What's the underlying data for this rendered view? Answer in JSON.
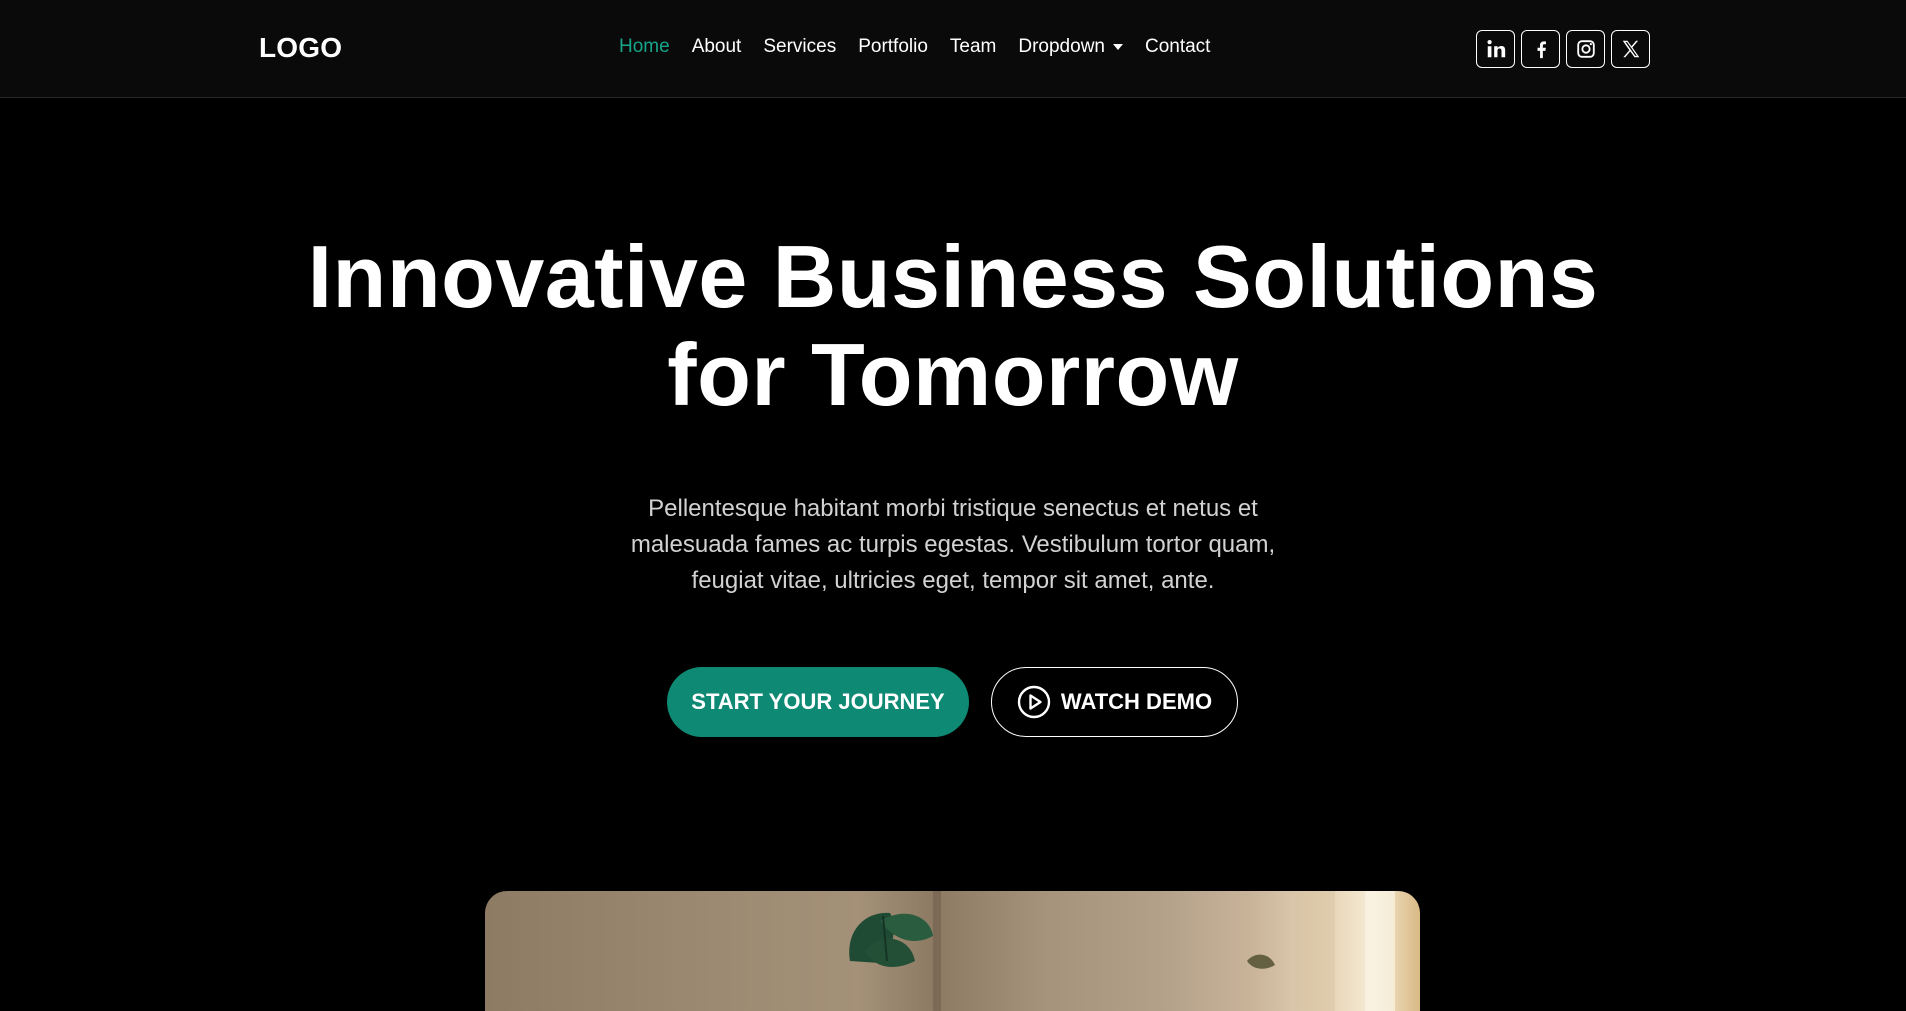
{
  "brand": {
    "logo": "LOGO",
    "accent": "#16a58a",
    "button_color": "#0e8a74"
  },
  "nav": {
    "items": [
      {
        "label": "Home",
        "active": true
      },
      {
        "label": "About"
      },
      {
        "label": "Services"
      },
      {
        "label": "Portfolio"
      },
      {
        "label": "Team"
      },
      {
        "label": "Dropdown",
        "has_caret": true
      },
      {
        "label": "Contact"
      }
    ]
  },
  "socials": [
    {
      "icon": "linkedin-icon"
    },
    {
      "icon": "facebook-icon"
    },
    {
      "icon": "instagram-icon"
    },
    {
      "icon": "x-twitter-icon"
    }
  ],
  "hero": {
    "title_line1": "Innovative Business Solutions",
    "title_line2": "for Tomorrow",
    "subtitle_line1": "Pellentesque habitant morbi tristique senectus et netus et",
    "subtitle_line2": "malesuada fames ac turpis egestas. Vestibulum tortor quam,",
    "subtitle_line3": "feugiat vitae, ultricies eget, tempor sit amet, ante.",
    "primary_button": "START YOUR JOURNEY",
    "secondary_button": "WATCH DEMO",
    "secondary_icon": "play-circle-icon"
  }
}
